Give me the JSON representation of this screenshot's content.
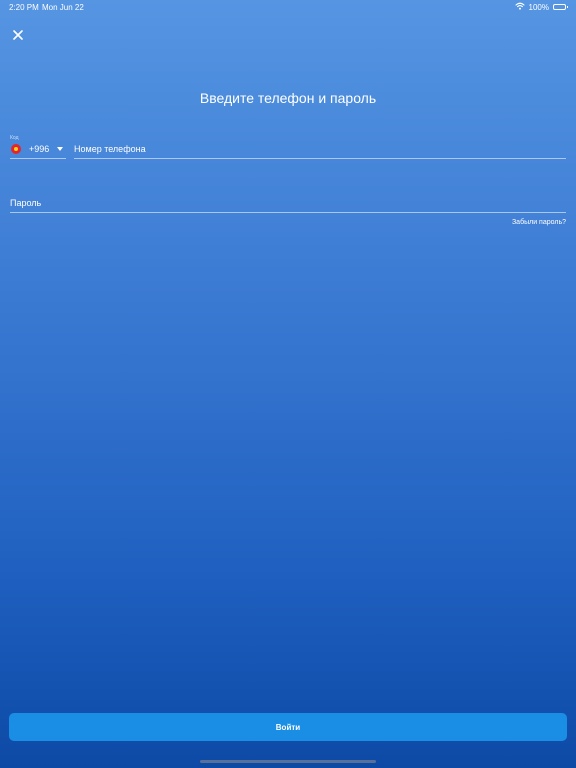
{
  "status_bar": {
    "time": "2:20 PM",
    "date": "Mon Jun 22",
    "battery": "100%",
    "icons": [
      "wifi-icon",
      "battery-icon"
    ]
  },
  "header": {
    "close_icon": "close-icon",
    "title": "Введите телефон и пароль"
  },
  "form": {
    "code_caption": "Код",
    "country_code": "+996",
    "country_flag": "kyrgyzstan-flag-icon",
    "phone_placeholder": "Номер телефона",
    "password_placeholder": "Пароль",
    "forgot_password": "Забыли пароль?"
  },
  "actions": {
    "login_label": "Войти"
  },
  "colors": {
    "background_top": "#5595e2",
    "background_bottom": "#0d4aa6",
    "button": "#1a8ee4",
    "flag_red": "#e5252a",
    "flag_yellow": "#f6d21c"
  }
}
